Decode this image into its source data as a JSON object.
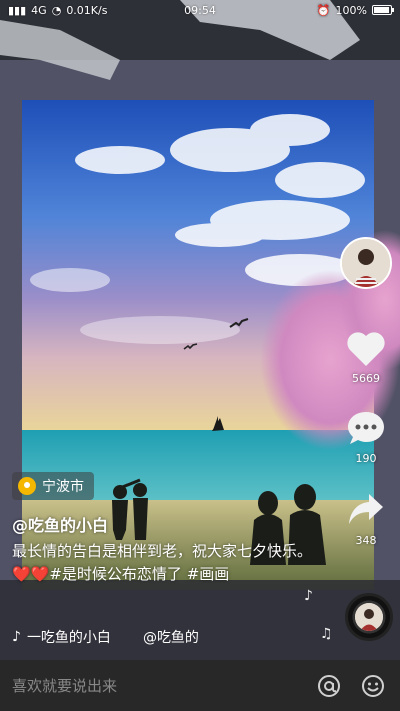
{
  "status_bar": {
    "network": "4G",
    "speed": "0.01K/s",
    "time": "09:54",
    "battery": "100%"
  },
  "right_rail": {
    "like_count": "5669",
    "comment_count": "190",
    "share_count": "348"
  },
  "location": "宁波市",
  "author": "@吃鱼的小白",
  "caption": "最长情的告白是相伴到老，祝大家七夕快乐。❤️❤️#是时候公布恋情了 #画画",
  "music": {
    "text": "一吃鱼的小白",
    "mention": "@吃鱼的"
  },
  "comment_bar": {
    "placeholder": "喜欢就要说出来"
  },
  "colors": {
    "accent_heart": "#ffffff",
    "location_pin": "#f5b700",
    "comment_bar_bg": "#282828"
  }
}
